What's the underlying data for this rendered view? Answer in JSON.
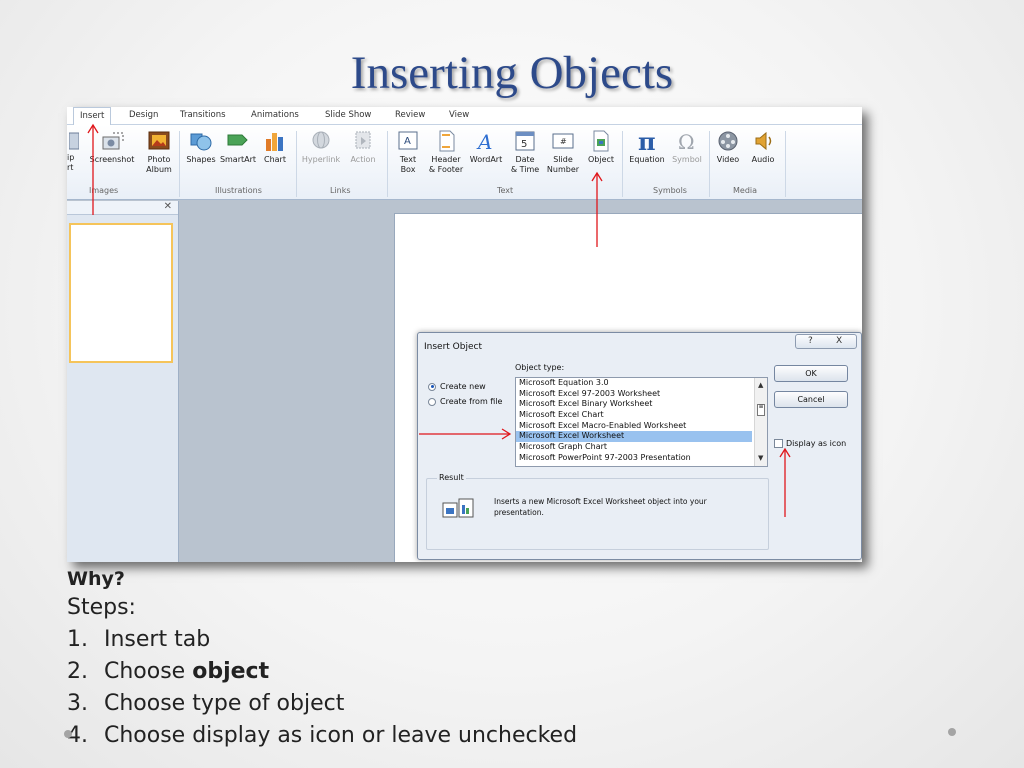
{
  "slide": {
    "title": "Inserting Objects",
    "why": "Why?",
    "steps_heading": "Steps:",
    "steps": [
      {
        "num": "1.",
        "text": "Insert tab",
        "bold": ""
      },
      {
        "num": "2.",
        "text": "Choose ",
        "bold": "object"
      },
      {
        "num": "3.",
        "text": "Choose type of object",
        "bold": ""
      },
      {
        "num": "4.",
        "text": "Choose display as icon or leave unchecked",
        "bold": ""
      }
    ]
  },
  "ribbon": {
    "tabs": [
      "Insert",
      "Design",
      "Transitions",
      "Animations",
      "Slide Show",
      "Review",
      "View"
    ],
    "buttons": {
      "clip_art_partial": [
        "ip",
        "rt"
      ],
      "screenshot": "Screenshot",
      "photo_album_1": "Photo",
      "photo_album_2": "Album",
      "shapes": "Shapes",
      "smartart": "SmartArt",
      "chart": "Chart",
      "hyperlink": "Hyperlink",
      "action": "Action",
      "text_box_1": "Text",
      "text_box_2": "Box",
      "header_footer_1": "Header",
      "header_footer_2": "& Footer",
      "wordart": "WordArt",
      "date_time_1": "Date",
      "date_time_2": "& Time",
      "slide_number_1": "Slide",
      "slide_number_2": "Number",
      "object": "Object",
      "equation": "Equation",
      "symbol": "Symbol",
      "video": "Video",
      "audio": "Audio"
    },
    "groups": [
      "Images",
      "Illustrations",
      "Links",
      "Text",
      "Symbols",
      "Media"
    ]
  },
  "dialog": {
    "title": "Insert Object",
    "help": "?",
    "close": "X",
    "create_new": "Create new",
    "create_from_file": "Create from file",
    "object_type_label": "Object type:",
    "object_types": [
      "Microsoft Equation 3.0",
      "Microsoft Excel 97-2003 Worksheet",
      "Microsoft Excel Binary Worksheet",
      "Microsoft Excel Chart",
      "Microsoft Excel Macro-Enabled Worksheet",
      "Microsoft Excel Worksheet",
      "Microsoft Graph Chart",
      "Microsoft PowerPoint 97-2003 Presentation"
    ],
    "selected_type": "Microsoft Excel Worksheet",
    "ok": "OK",
    "cancel": "Cancel",
    "display_as_icon": "Display as icon",
    "result_label": "Result",
    "result_text": "Inserts a new Microsoft Excel Worksheet object into your presentation."
  },
  "colors": {
    "title": "#2d4a8a",
    "arrow": "#e0161b",
    "selection": "#99c2ef"
  }
}
